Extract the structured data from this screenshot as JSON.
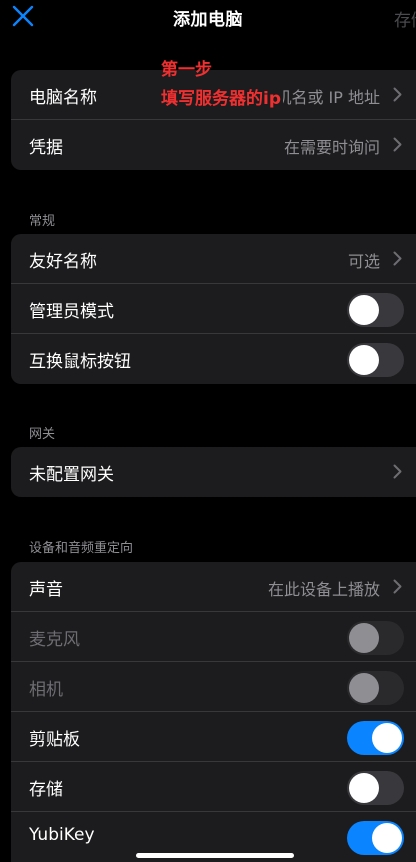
{
  "nav": {
    "title": "添加电脑",
    "save_label": "存储",
    "close_icon": "close-icon"
  },
  "connection": {
    "rows": [
      {
        "label": "电脑名称",
        "value": "主机名或 IP 地址",
        "chevron": true
      },
      {
        "label": "凭据",
        "value": "在需要时询问",
        "chevron": true
      }
    ]
  },
  "annotation": {
    "line1": "第一步",
    "line2": "填写服务器的ip",
    "color": "#f03030"
  },
  "general": {
    "header": "常规",
    "rows": [
      {
        "label": "友好名称",
        "value": "可选",
        "chevron": true
      },
      {
        "label": "管理员模式",
        "toggle": false
      },
      {
        "label": "互换鼠标按钮",
        "toggle": false
      }
    ]
  },
  "gateway": {
    "header": "网关",
    "rows": [
      {
        "label": "未配置网关",
        "chevron": true
      }
    ]
  },
  "redirection": {
    "header": "设备和音频重定向",
    "rows": [
      {
        "label": "声音",
        "value": "在此设备上播放",
        "chevron": true
      },
      {
        "label": "麦克风",
        "toggle": false,
        "disabled": true
      },
      {
        "label": "相机",
        "toggle": false,
        "disabled": true
      },
      {
        "label": "剪贴板",
        "toggle": true
      },
      {
        "label": "存储",
        "toggle": false
      },
      {
        "label": "YubiKey",
        "toggle": true
      }
    ]
  },
  "colors": {
    "background": "#000000",
    "group": "#1c1c1e",
    "accent": "#0a84ff",
    "secondary_text": "#8e8e93"
  }
}
